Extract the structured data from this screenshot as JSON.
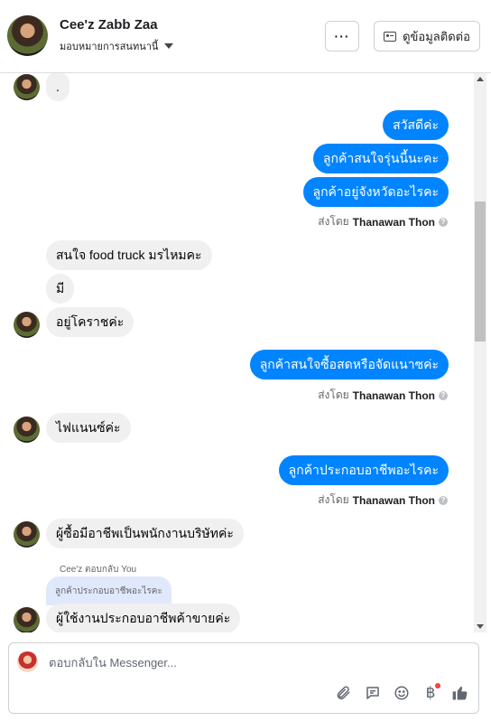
{
  "header": {
    "contact_name": "Cee'z Zabb Zaa",
    "assign_label": "มอบหมายการสนทนานี้",
    "more_label": "···",
    "contact_info_label": "ดูข้อมูลติดต่อ"
  },
  "thread": {
    "m1": ".",
    "m2": "สวัสดีค่ะ",
    "m3": "ลูกค้าสนใจรุ่นนี้นะคะ",
    "m4": "ลูกค้าอยู่จังหวัดอะไรคะ",
    "sent_by_prefix": "ส่งโดย",
    "sender": "Thanawan Thon",
    "help_mark": "?",
    "m5": "สนใจ food truck มรไหมคะ",
    "m6": "มี",
    "m7": "อยู่โคราชค่ะ",
    "m8": "ลูกค้าสนใจซื้อสดหรือจัดแนาซค่ะ",
    "m9": "ไฟแนนซ์ค่ะ",
    "m10": "ลูกค้าประกอบอาชีพอะไรคะ",
    "m11": "ผู้ซื้อมีอาชีพเป็นพนักงานบริษัทค่ะ",
    "reply_label": "Cee'z ตอบกลับ You",
    "quoted": "ลูกค้าประกอบอาชีพอะไรคะ",
    "m12": "ผู้ใช้งานประกอบอาชีพค้าขายค่ะ"
  },
  "composer": {
    "placeholder": "ตอบกลับใน Messenger..."
  },
  "colors": {
    "outgoing": "#0084ff",
    "incoming": "#f0f0f0",
    "quoted": "#dfe9fb",
    "notification": "#fa3e3e"
  },
  "icons": [
    "dropdown-caret-icon",
    "contact-card-icon",
    "paperclip-icon",
    "saved-replies-icon",
    "emoji-icon",
    "baht-payment-icon",
    "like-thumb-icon",
    "help-icon"
  ]
}
